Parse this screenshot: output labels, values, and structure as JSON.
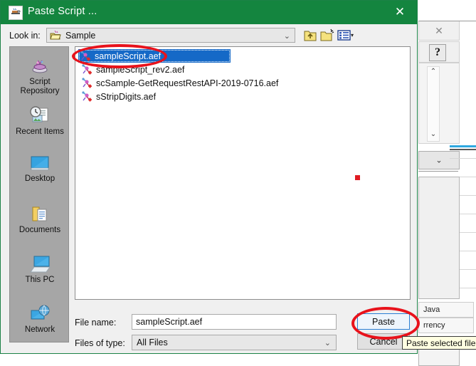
{
  "background_window": {
    "close_icon": "close-icon",
    "help_icon": "question-mark-icon",
    "help_label": "?",
    "close_label": "✕",
    "scroll_up_label": "⌃",
    "scroll_down_label": "⌄",
    "combo_chevron_label": "⌄",
    "rows": [
      {
        "label": "Java"
      },
      {
        "label": "rrency"
      }
    ]
  },
  "dialog": {
    "title": "Paste Script ...",
    "title_icon": "java-cup-icon",
    "close_label": "✕",
    "lookin": {
      "label": "Look in:",
      "value": "Sample",
      "icon": "open-folder-icon",
      "chevron": "⌄"
    },
    "toolbar": [
      {
        "name": "up-one-level-button",
        "tooltip": "Up One Level"
      },
      {
        "name": "create-new-folder-button",
        "tooltip": "Create New Folder"
      },
      {
        "name": "view-menu-button",
        "tooltip": "List",
        "chevron": "▾"
      }
    ],
    "places": [
      {
        "label": "Script\nRepository",
        "label_line1": "Script",
        "label_line2": "Repository",
        "icon": "script-repository-icon"
      },
      {
        "label": "Recent Items",
        "label_line1": "Recent Items",
        "label_line2": "",
        "icon": "recent-items-icon"
      },
      {
        "label": "Desktop",
        "label_line1": "Desktop",
        "label_line2": "",
        "icon": "desktop-icon"
      },
      {
        "label": "Documents",
        "label_line1": "Documents",
        "label_line2": "",
        "icon": "documents-folder-icon"
      },
      {
        "label": "This PC",
        "label_line1": "This PC",
        "label_line2": "",
        "icon": "this-pc-icon"
      },
      {
        "label": "Network",
        "label_line1": "Network",
        "label_line2": "",
        "icon": "network-icon"
      }
    ],
    "files": [
      {
        "name": "sampleScript.aef",
        "selected": true,
        "icon": "aef-script-file-icon"
      },
      {
        "name": "sampleScript_rev2.aef",
        "selected": false,
        "icon": "aef-script-file-icon"
      },
      {
        "name": "scSample-GetRequestRestAPI-2019-0716.aef",
        "selected": false,
        "icon": "aef-script-file-icon"
      },
      {
        "name": "sStripDigits.aef",
        "selected": false,
        "icon": "aef-script-file-icon"
      }
    ],
    "filename": {
      "label": "File name:",
      "value": "sampleScript.aef",
      "placeholder": ""
    },
    "filetype": {
      "label": "Files of type:",
      "value": "All Files",
      "chevron": "⌄"
    },
    "buttons": {
      "paste": "Paste",
      "cancel": "Cancel"
    },
    "tooltip": "Paste selected file"
  },
  "annotations": [
    {
      "name": "highlight-selected-file",
      "shape": "ellipse",
      "color": "#e8121b"
    },
    {
      "name": "highlight-paste-button",
      "shape": "ellipse",
      "color": "#e8121b"
    }
  ],
  "cursor_marker": {
    "name": "cursor-position-marker",
    "color": "#e01b22"
  },
  "colors": {
    "title_bar_green": "#14853f",
    "selection_blue": "#1569c7",
    "annotation_red": "#e8121b",
    "dialog_face": "#f0f0f0",
    "places_bar": "#a6a6a6",
    "focus_button_border": "#2a7fd4",
    "tooltip_bg": "#ffffe1"
  }
}
